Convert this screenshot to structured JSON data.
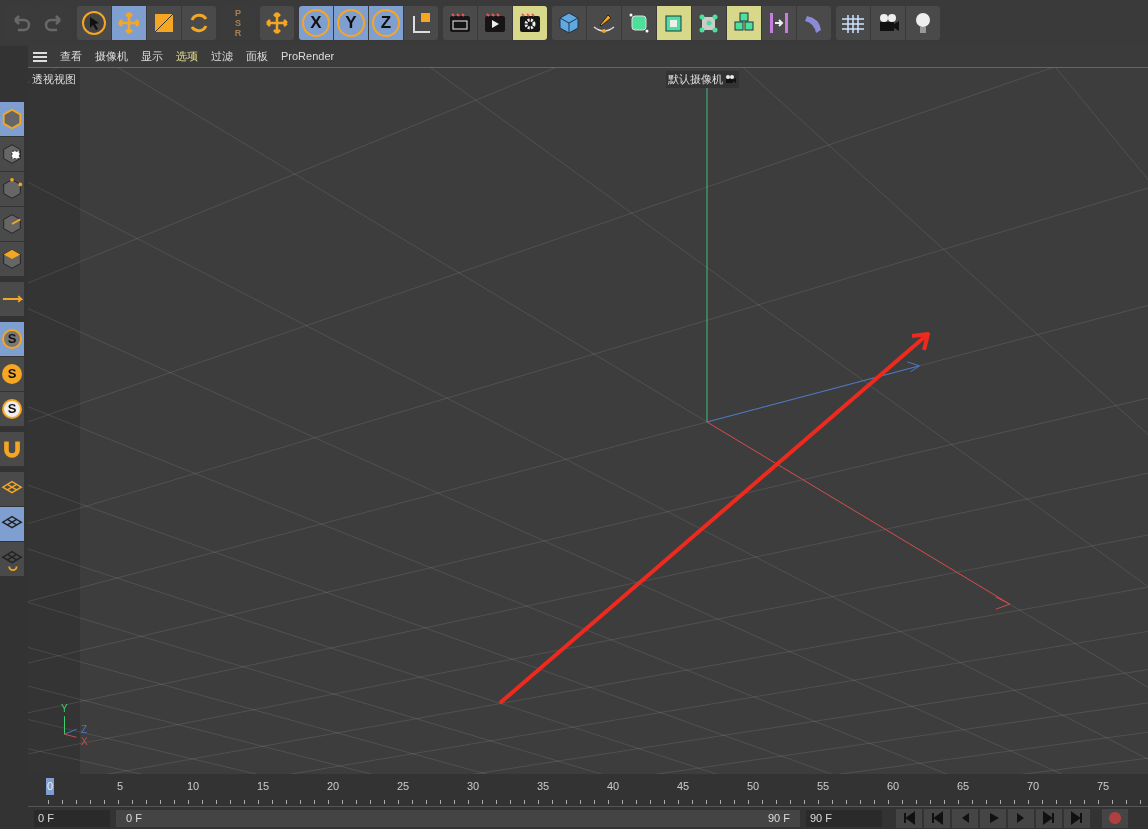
{
  "top_toolbar": {
    "groups": [
      {
        "items": [
          {
            "kind": "undo",
            "disabled": true
          },
          {
            "kind": "redo",
            "disabled": true
          }
        ]
      },
      {
        "items": [
          {
            "kind": "select",
            "selected": false
          },
          {
            "kind": "move",
            "selected": true
          },
          {
            "kind": "scale",
            "selected": false
          },
          {
            "kind": "rotate",
            "selected": false
          }
        ]
      },
      {
        "items": [
          {
            "kind": "psr",
            "letters": [
              "P",
              "S",
              "R"
            ],
            "disabled": true
          }
        ]
      },
      {
        "items": [
          {
            "kind": "transform",
            "selected": false
          }
        ]
      },
      {
        "items": [
          {
            "kind": "axis-lock",
            "label": "X",
            "selected": true
          },
          {
            "kind": "axis-lock",
            "label": "Y",
            "selected": true
          },
          {
            "kind": "axis-lock",
            "label": "Z",
            "selected": true
          },
          {
            "kind": "coord-system",
            "selected": false
          }
        ]
      },
      {
        "items": [
          {
            "kind": "render-view",
            "selected": false
          },
          {
            "kind": "render",
            "selected": false
          },
          {
            "kind": "render-settings",
            "selected": true
          }
        ]
      },
      {
        "items": [
          {
            "kind": "cube",
            "selected": false
          },
          {
            "kind": "pen",
            "selected": false
          },
          {
            "kind": "subdivision",
            "selected": false
          },
          {
            "kind": "frame-cube",
            "selected": true
          },
          {
            "kind": "node-cube",
            "selected": false
          },
          {
            "kind": "cubes",
            "selected": true
          },
          {
            "kind": "bars",
            "selected": false
          },
          {
            "kind": "bend",
            "selected": false
          }
        ]
      },
      {
        "items": [
          {
            "kind": "floor",
            "selected": false
          },
          {
            "kind": "camera",
            "selected": false
          },
          {
            "kind": "light",
            "selected": false
          }
        ]
      }
    ]
  },
  "left_toolbar": {
    "groups": [
      {
        "items": [
          {
            "kind": "model",
            "selected": true
          },
          {
            "kind": "texture",
            "selected": false
          },
          {
            "kind": "points",
            "selected": false
          },
          {
            "kind": "edges",
            "selected": false
          },
          {
            "kind": "polygons",
            "selected": false
          }
        ]
      },
      {
        "items": [
          {
            "kind": "axis",
            "selected": false
          }
        ]
      },
      {
        "items": [
          {
            "kind": "snap",
            "label": "S",
            "selected": true
          },
          {
            "kind": "snap-filled",
            "label": "S",
            "selected": false
          },
          {
            "kind": "snap-light",
            "label": "S",
            "selected": false
          }
        ]
      },
      {
        "items": [
          {
            "kind": "magnet",
            "selected": false
          }
        ]
      },
      {
        "items": [
          {
            "kind": "plane-outline",
            "selected": false
          },
          {
            "kind": "plane-grid",
            "selected": true
          },
          {
            "kind": "plane-rotate",
            "selected": false
          }
        ]
      }
    ]
  },
  "viewport": {
    "menu": [
      {
        "label": "查看",
        "selected": false
      },
      {
        "label": "摄像机",
        "selected": false
      },
      {
        "label": "显示",
        "selected": false
      },
      {
        "label": "选项",
        "selected": true
      },
      {
        "label": "过滤",
        "selected": false
      },
      {
        "label": "面板",
        "selected": false
      },
      {
        "label": "ProRender",
        "selected": false
      }
    ],
    "view_name": "透视视图",
    "camera_label": "默认摄像机",
    "gizmo": {
      "y": "Y",
      "z": "Z",
      "x": "X"
    }
  },
  "timeline": {
    "ruler": [
      {
        "text": "0",
        "selected": true
      },
      {
        "text": "5",
        "selected": false
      },
      {
        "text": "10",
        "selected": false
      },
      {
        "text": "15",
        "selected": false
      },
      {
        "text": "20",
        "selected": false
      },
      {
        "text": "25",
        "selected": false
      },
      {
        "text": "30",
        "selected": false
      },
      {
        "text": "35",
        "selected": false
      },
      {
        "text": "40",
        "selected": false
      },
      {
        "text": "45",
        "selected": false
      },
      {
        "text": "50",
        "selected": false
      },
      {
        "text": "55",
        "selected": false
      },
      {
        "text": "60",
        "selected": false
      },
      {
        "text": "65",
        "selected": false
      },
      {
        "text": "70",
        "selected": false
      },
      {
        "text": "75",
        "selected": false
      }
    ],
    "start_field": "0 F",
    "range": {
      "start": "0 F",
      "end": "90 F",
      "level": 1
    },
    "end_field": "90 F",
    "controls": [
      {
        "kind": "first"
      },
      {
        "kind": "prev-key"
      },
      {
        "kind": "prev-frame"
      },
      {
        "kind": "play"
      },
      {
        "kind": "next-frame"
      },
      {
        "kind": "next-key"
      },
      {
        "kind": "last"
      },
      {
        "kind": "record"
      }
    ]
  }
}
